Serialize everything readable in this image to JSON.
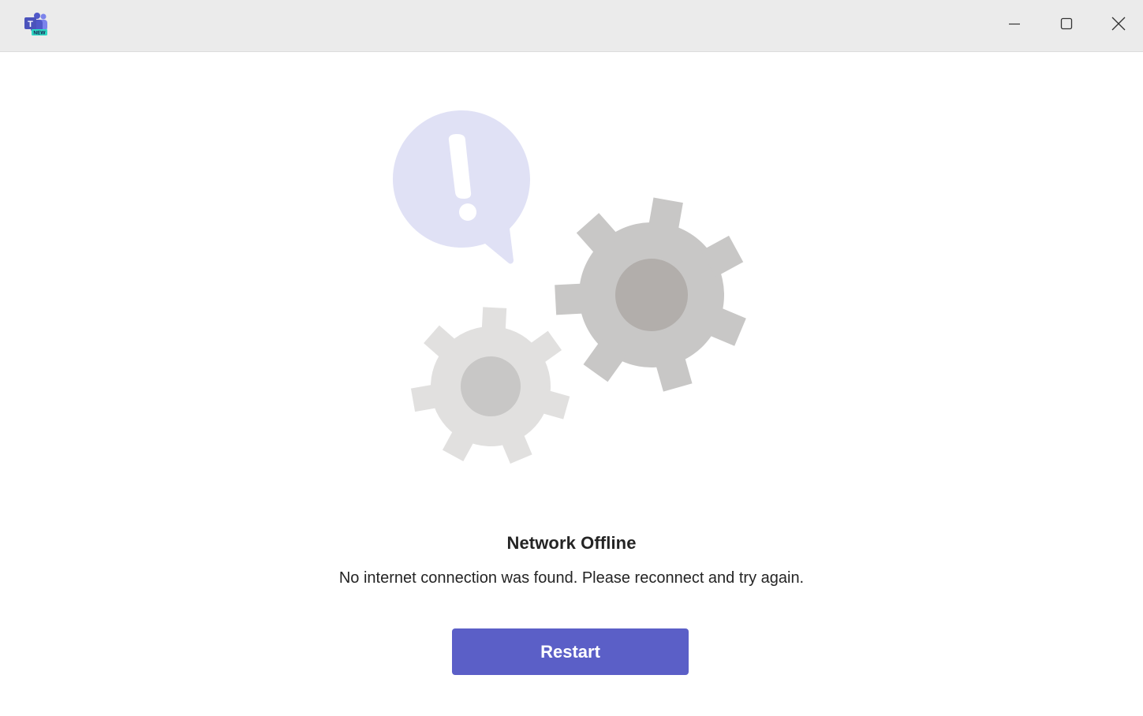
{
  "window": {
    "app_icon": "teams-new-icon",
    "app_badge": "NEW",
    "controls": {
      "minimize": "minimize-icon",
      "maximize": "maximize-icon",
      "close": "close-icon"
    }
  },
  "error": {
    "illustration": "network-offline-gears-illustration",
    "title": "Network Offline",
    "message": "No internet connection was found. Please reconnect and try again.",
    "button_label": "Restart"
  },
  "colors": {
    "accent": "#5b5fc7",
    "titlebar_bg": "#ebebeb",
    "bubble": "#e0e1f5",
    "gear_dark": "#c8c7c6",
    "gear_dark_hub": "#b2aeab",
    "gear_light": "#e1e0df",
    "gear_light_hub": "#c8c7c6"
  }
}
